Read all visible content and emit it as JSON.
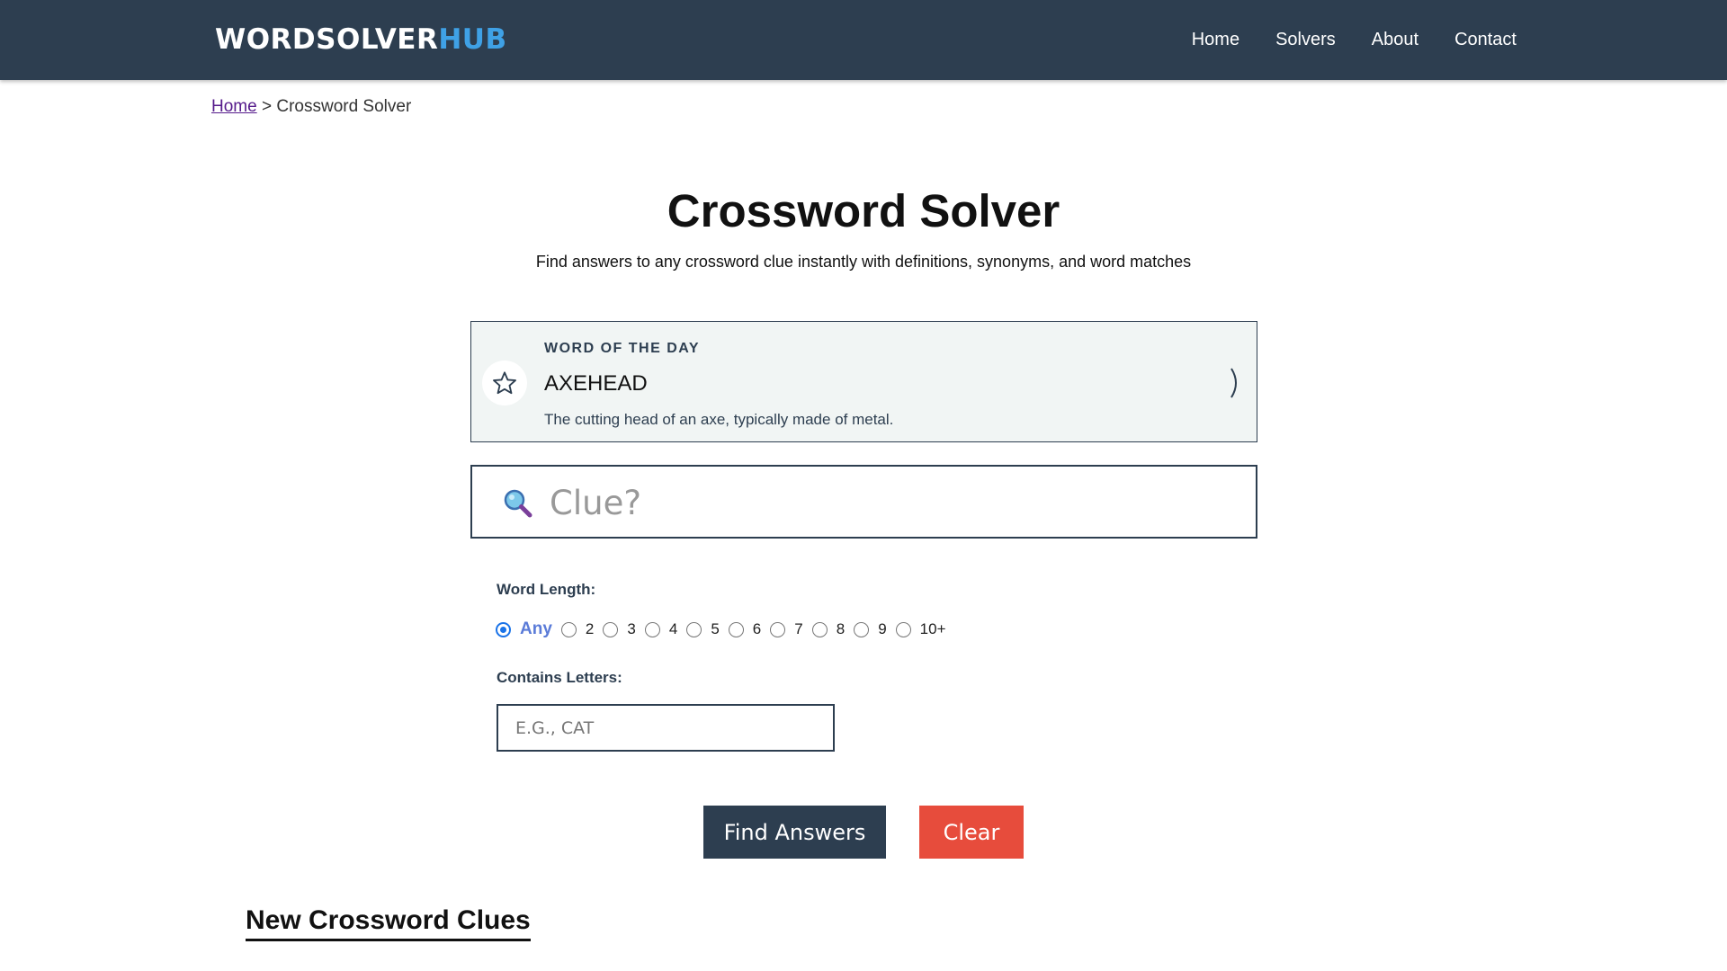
{
  "header": {
    "logo_main": "WORDSOLVER",
    "logo_accent": "HUB",
    "nav": [
      {
        "label": "Home"
      },
      {
        "label": "Solvers"
      },
      {
        "label": "About"
      },
      {
        "label": "Contact"
      }
    ]
  },
  "breadcrumb": {
    "home": "Home",
    "separator": ">",
    "current": "Crossword Solver"
  },
  "main": {
    "title": "Crossword Solver",
    "subtitle": "Find answers to any crossword clue instantly with definitions, synonyms, and word matches"
  },
  "word_of_the_day": {
    "label": "WORD OF THE DAY",
    "word": "AXEHEAD",
    "definition": "The cutting head of an axe, typically made of metal.",
    "icon": "star-icon",
    "arrow_icon": "chevron-right-icon"
  },
  "search": {
    "placeholder": "Clue?",
    "value": "",
    "icon": "search-icon"
  },
  "word_length": {
    "label": "Word Length:",
    "selected": "Any",
    "options": [
      "Any",
      "2",
      "3",
      "4",
      "5",
      "6",
      "7",
      "8",
      "9",
      "10+"
    ]
  },
  "contains": {
    "label": "Contains Letters:",
    "placeholder": "E.G., CAT",
    "value": ""
  },
  "buttons": {
    "find": "Find Answers",
    "clear": "Clear"
  },
  "sections": {
    "new_clues_heading": "New Crossword Clues"
  },
  "colors": {
    "header_bg": "#2d3e50",
    "logo_accent": "#3fa1e6",
    "clear_button": "#e74c3c",
    "card_bg": "#f1f5f4",
    "radio_checked": "#1a73e8"
  }
}
